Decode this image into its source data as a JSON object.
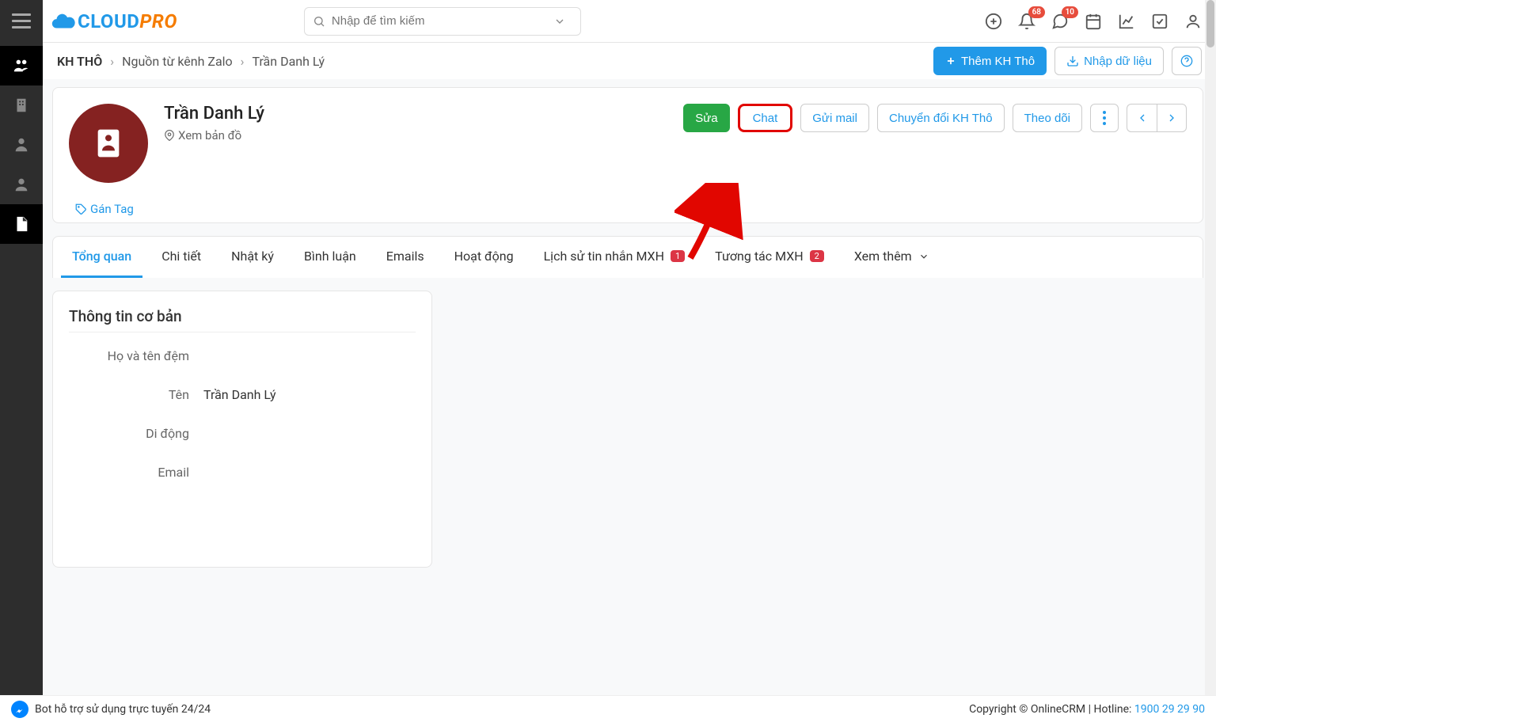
{
  "logo": {
    "cloud": "CLOUD",
    "pro": "PRO"
  },
  "search": {
    "placeholder": "Nhập để tìm kiếm"
  },
  "badges": {
    "bell": "68",
    "chat": "10"
  },
  "breadcrumbs": {
    "root": "KH THÔ",
    "seg1": "Nguồn từ kênh Zalo",
    "seg2": "Trần Danh Lý"
  },
  "headerActions": {
    "add": "Thêm KH Thô",
    "import": "Nhập dữ liệu"
  },
  "record": {
    "name": "Trần Danh Lý",
    "map": "Xem bản đồ",
    "tag": "Gán Tag",
    "buttons": {
      "edit": "Sửa",
      "chat": "Chat",
      "mail": "Gửi mail",
      "convert": "Chuyển đổi KH Thô",
      "follow": "Theo dõi"
    }
  },
  "tabs": {
    "overview": "Tổng quan",
    "detail": "Chi tiết",
    "log": "Nhật ký",
    "comment": "Bình luận",
    "emails": "Emails",
    "activity": "Hoạt động",
    "history": "Lịch sử tin nhắn MXH",
    "historyCount": "1",
    "interact": "Tương tác MXH",
    "interactCount": "2",
    "more": "Xem thêm"
  },
  "panel": {
    "title": "Thông tin cơ bản",
    "fields": {
      "lastnameLabel": "Họ và tên đệm",
      "lastnameValue": "",
      "firstnameLabel": "Tên",
      "firstnameValue": "Trần Danh Lý",
      "mobileLabel": "Di động",
      "mobileValue": "",
      "emailLabel": "Email",
      "emailValue": ""
    }
  },
  "footer": {
    "bot": "Bot hỗ trợ sử dụng trực tuyến 24/24",
    "copyright": "Copyright © OnlineCRM",
    "hotlineLabel": "Hotline:",
    "hotlinePhone": "1900 29 29 90"
  }
}
